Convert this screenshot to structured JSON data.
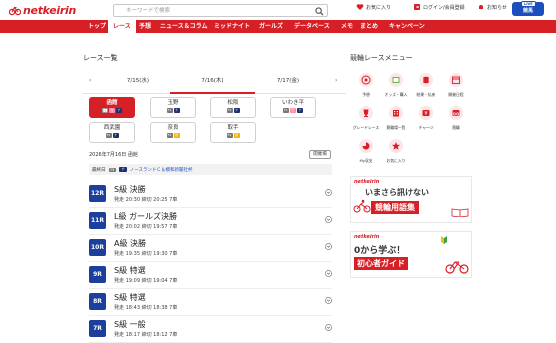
{
  "header": {
    "logo": "netkeirin",
    "search_placeholder": "キーワードで検索",
    "favorites": "お気に入り",
    "login": "ログイン/会員登録",
    "notifications": "お知らせ",
    "live_badge": "LIVE",
    "live_label": "競馬"
  },
  "nav": [
    "トップ",
    "レース",
    "予想",
    "ニュース＆コラム",
    "ミッドナイト",
    "ガールズ",
    "データベース",
    "メモ",
    "まとめ",
    "キャンペーン"
  ],
  "nav_active": "レース",
  "race_list": {
    "title": "レース一覧",
    "dates": [
      "7/15(水)",
      "7/16(木)",
      "7/17(金)"
    ],
    "active_date": "7/16(木)",
    "venues": [
      {
        "name": "函館",
        "active": true,
        "icons": [
          "F1",
          "ミ",
          "ナ"
        ]
      },
      {
        "name": "玉野",
        "active": false,
        "icons": [
          "F1",
          "ナ"
        ]
      },
      {
        "name": "松阪",
        "active": false,
        "icons": [
          "F1",
          "ナ"
        ]
      },
      {
        "name": "いわき平",
        "active": false,
        "icons": [
          "F1",
          "モ",
          "ナ"
        ]
      },
      {
        "name": "西武園",
        "active": false,
        "icons": [
          "F2",
          "ナ"
        ]
      },
      {
        "name": "奈良",
        "active": false,
        "icons": [
          "F2",
          "昼"
        ]
      },
      {
        "name": "取手",
        "active": false,
        "icons": [
          "F2",
          "昼"
        ]
      }
    ],
    "info": "2026年7月16日 函館",
    "venue_info_button": "開催場",
    "last_race_label": "最終日",
    "last_race_tag1": "FⅡ",
    "last_race_tag2": "ナ",
    "last_race_name": "ノースランドＣ＆模和新聞社杯",
    "races": [
      {
        "num": "12R",
        "name": "S級 決勝",
        "time": "発走 20:30  締切 20:25  7車"
      },
      {
        "num": "11R",
        "name": "L級 ガールズ決勝",
        "time": "発走 20:02  締切 19:57  7車"
      },
      {
        "num": "10R",
        "name": "A級 決勝",
        "time": "発走 19:35  締切 19:30  7車"
      },
      {
        "num": "9R",
        "name": "S級 特選",
        "time": "発走 19:09  締切 19:04  7車"
      },
      {
        "num": "8R",
        "name": "S級 特選",
        "time": "発走 18:43  締切 18:38  7車"
      },
      {
        "num": "7R",
        "name": "S級 一般",
        "time": "発走 18:17  締切 18:12  7車"
      }
    ]
  },
  "menu": {
    "title": "競輪レースメニュー",
    "items": [
      {
        "label": "予想",
        "icon": "target-icon"
      },
      {
        "label": "オッズ・購入",
        "icon": "odds-icon"
      },
      {
        "label": "結果・払戻",
        "icon": "coins-icon"
      },
      {
        "label": "開催日程",
        "icon": "calendar-icon"
      },
      {
        "label": "グレードレース",
        "icon": "trophy-icon"
      },
      {
        "label": "競輪場一覧",
        "icon": "building-icon"
      },
      {
        "label": "チャージ",
        "icon": "yen-icon"
      },
      {
        "label": "競輪",
        "icon": "bicycle-icon"
      },
      {
        "label": "My収支",
        "icon": "chart-icon"
      },
      {
        "label": "お気に入り",
        "icon": "star-icon"
      }
    ]
  },
  "banners": [
    {
      "logo": "netkeirin",
      "line1": "いまさら訊けない",
      "line2": "競輪用語集"
    },
    {
      "logo": "netkeirin",
      "line1": "0から学ぶ！",
      "line2": "初心者ガイド"
    }
  ],
  "colors": {
    "brand": "#d71f26",
    "race_num": "#1d3f9c",
    "live": "#1c4fbd"
  }
}
